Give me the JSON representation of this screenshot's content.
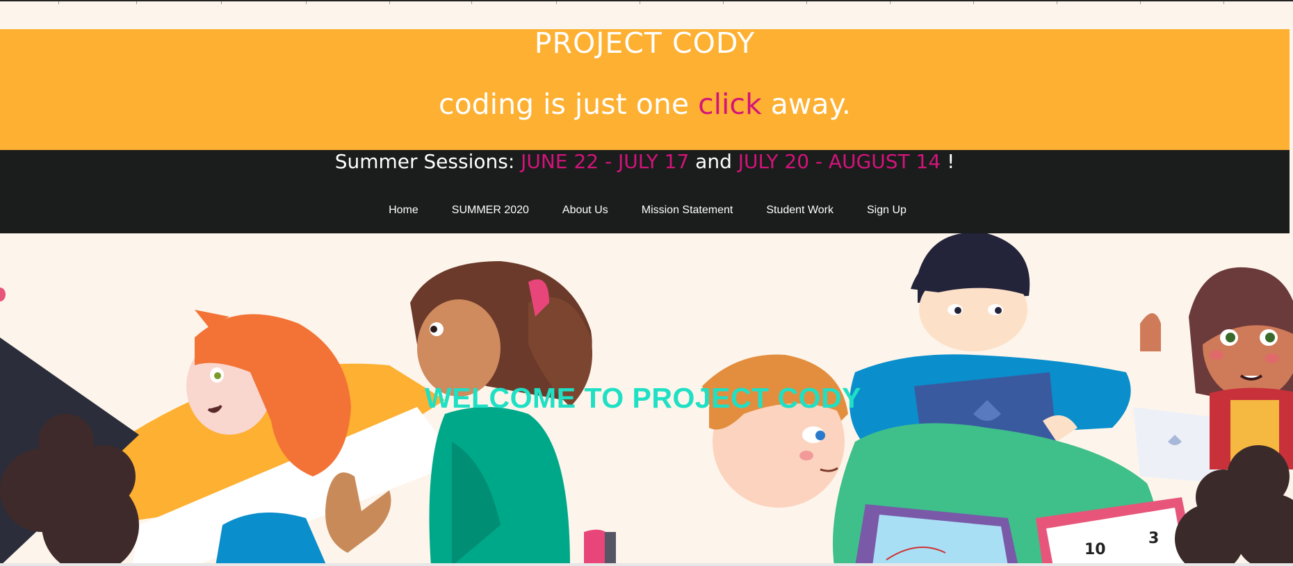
{
  "header": {
    "title": "PROJECT CODY",
    "tagline_before": "coding is just one ",
    "tagline_accent": "click",
    "tagline_after": " away."
  },
  "sessions": {
    "prefix": "Summer Sessions: ",
    "session1": "JUNE 22 - JULY 17",
    "joiner": " and ",
    "session2": "JULY 20 - AUGUST 14",
    "suffix": " !"
  },
  "nav": {
    "items": [
      "Home",
      "SUMMER 2020",
      "About Us",
      "Mission Statement",
      "Student Work",
      "Sign Up"
    ]
  },
  "hero": {
    "welcome": "WELCOME TO PROJECT CODY",
    "tablet_numbers": [
      "10",
      "3"
    ]
  },
  "colors": {
    "banner": "#fdb031",
    "dark_bar": "#1b1c1c",
    "accent_magenta": "#d4147a",
    "welcome_teal": "#1fe0c4",
    "page_bg": "#fdf5eb"
  }
}
